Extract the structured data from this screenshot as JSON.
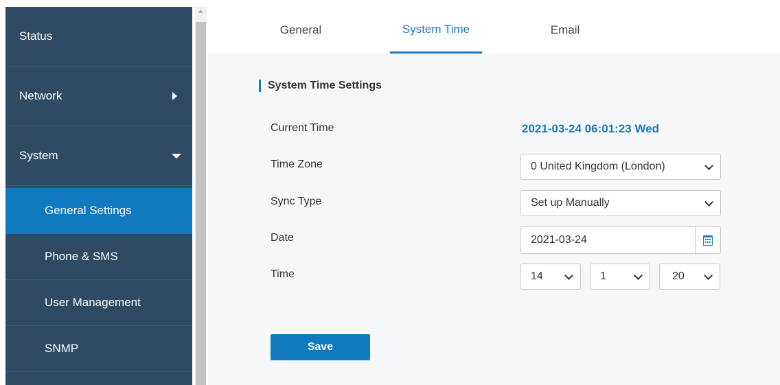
{
  "sidebar": {
    "items": [
      {
        "label": "Status"
      },
      {
        "label": "Network",
        "icon": "caret-right-icon"
      },
      {
        "label": "System",
        "icon": "caret-down-icon"
      }
    ],
    "subitems": [
      {
        "label": "General Settings",
        "active": true
      },
      {
        "label": "Phone & SMS"
      },
      {
        "label": "User Management"
      },
      {
        "label": "SNMP"
      }
    ]
  },
  "tabs": [
    {
      "label": "General"
    },
    {
      "label": "System Time",
      "active": true
    },
    {
      "label": "Email"
    }
  ],
  "section": {
    "title": "System Time Settings"
  },
  "fields": {
    "current_time_label": "Current Time",
    "current_time_value": "2021-03-24 06:01:23 Wed",
    "time_zone_label": "Time Zone",
    "time_zone_value": "0 United Kingdom (London)",
    "sync_type_label": "Sync Type",
    "sync_type_value": "Set up Manually",
    "date_label": "Date",
    "date_value": "2021-03-24",
    "time_label": "Time",
    "time_hour": "14",
    "time_minute": "1",
    "time_second": "20"
  },
  "actions": {
    "save_label": "Save"
  },
  "colors": {
    "sidebar_bg": "#2f4b63",
    "active_bg": "#0f7ac0",
    "accent": "#1b7ab8"
  }
}
